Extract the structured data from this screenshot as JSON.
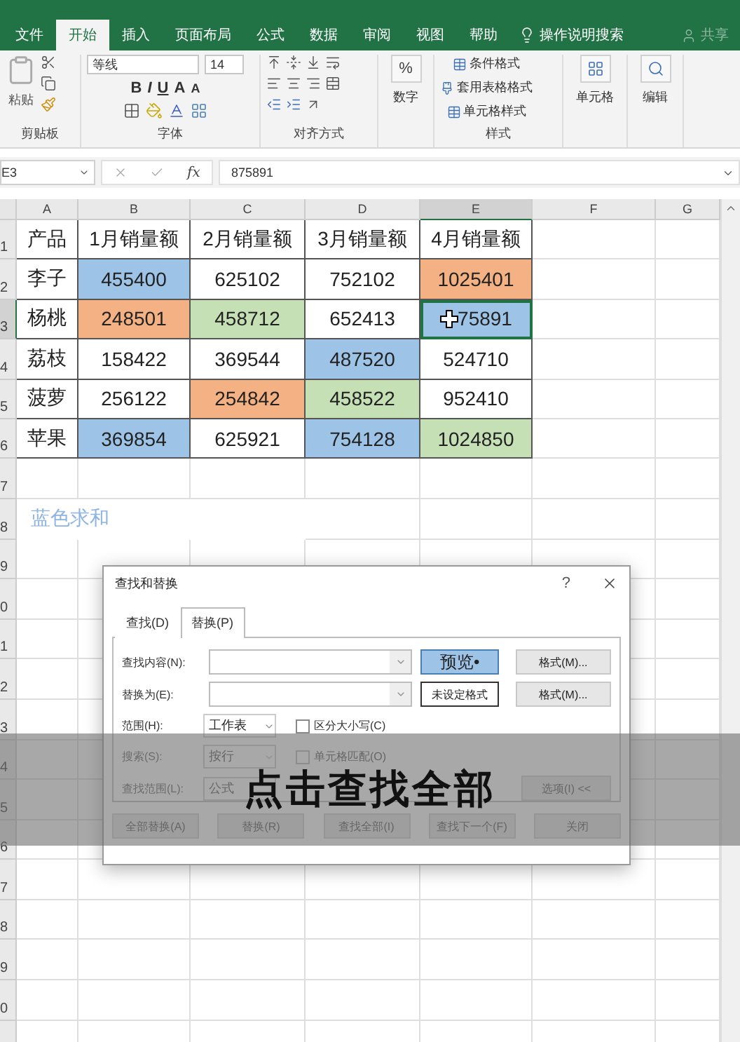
{
  "ribbon_tabs": [
    {
      "label": "文件",
      "selected": false
    },
    {
      "label": "开始",
      "selected": true
    },
    {
      "label": "插入",
      "selected": false
    },
    {
      "label": "页面布局",
      "selected": false
    },
    {
      "label": "公式",
      "selected": false
    },
    {
      "label": "数据",
      "selected": false
    },
    {
      "label": "审阅",
      "selected": false
    },
    {
      "label": "视图",
      "selected": false
    },
    {
      "label": "帮助",
      "selected": false
    }
  ],
  "tell_me": "操作说明搜索",
  "share": "共享",
  "ribbon": {
    "paste": "粘贴",
    "clipboard_label": "剪贴板",
    "font_name": "等线",
    "font_size": "14",
    "bold": "B",
    "italic": "I",
    "underline": "U",
    "grow": "A",
    "shrink": "A",
    "font_label": "字体",
    "align_label": "对齐方式",
    "percent": "%",
    "number": "数字",
    "styles": [
      "条件格式",
      "套用表格格式",
      "单元格样式"
    ],
    "styles_label": "样式",
    "cells": "单元格",
    "editing": "编辑"
  },
  "formula_bar": {
    "name_box": "E3",
    "fx": "fx",
    "formula": "875891"
  },
  "sheet": {
    "columns": [
      {
        "label": "A",
        "selected": false
      },
      {
        "label": "B",
        "selected": false
      },
      {
        "label": "C",
        "selected": false
      },
      {
        "label": "D",
        "selected": false
      },
      {
        "label": "E",
        "selected": true
      },
      {
        "label": "F",
        "selected": false
      },
      {
        "label": "G",
        "selected": false
      }
    ],
    "row_headers": [
      {
        "label": "1",
        "selected": false
      },
      {
        "label": "2",
        "selected": false
      },
      {
        "label": "3",
        "selected": true
      },
      {
        "label": "4",
        "selected": false
      },
      {
        "label": "5",
        "selected": false
      },
      {
        "label": "6",
        "selected": false
      },
      {
        "label": "7",
        "selected": false
      },
      {
        "label": "8",
        "selected": false
      },
      {
        "label": "9",
        "selected": false
      },
      {
        "label": "0",
        "selected": false
      },
      {
        "label": "1",
        "selected": false
      },
      {
        "label": "2",
        "selected": false
      },
      {
        "label": "3",
        "selected": false
      },
      {
        "label": "4",
        "selected": false
      },
      {
        "label": "5",
        "selected": false
      },
      {
        "label": "6",
        "selected": false
      },
      {
        "label": "7",
        "selected": false
      },
      {
        "label": "8",
        "selected": false
      },
      {
        "label": "9",
        "selected": false
      },
      {
        "label": "0",
        "selected": false
      }
    ],
    "rows": [
      {
        "cells": [
          {
            "text": "产品",
            "selected": false
          },
          {
            "text": "1月销量额",
            "selected": false
          },
          {
            "text": "2月销量额",
            "selected": false
          },
          {
            "text": "3月销量额",
            "selected": false
          },
          {
            "text": "4月销量额",
            "selected": false
          }
        ]
      },
      {
        "cells": [
          {
            "text": "李子",
            "selected": false
          },
          {
            "text": "455400",
            "selected": false,
            "color": "#9dc3e6"
          },
          {
            "text": "625102",
            "selected": false
          },
          {
            "text": "752102",
            "selected": false
          },
          {
            "text": "1025401",
            "selected": false,
            "color": "#f4b183"
          }
        ]
      },
      {
        "cells": [
          {
            "text": "杨桃",
            "selected": false
          },
          {
            "text": "248501",
            "selected": false,
            "color": "#f4b183"
          },
          {
            "text": "458712",
            "selected": false,
            "color": "#c5e0b4"
          },
          {
            "text": "652413",
            "selected": false
          },
          {
            "text": "75891",
            "selected": true,
            "color": "#9dc3e6"
          }
        ]
      },
      {
        "cells": [
          {
            "text": "荔枝",
            "selected": false
          },
          {
            "text": "158422",
            "selected": false
          },
          {
            "text": "369544",
            "selected": false
          },
          {
            "text": "487520",
            "selected": false,
            "color": "#9dc3e6"
          },
          {
            "text": "524710",
            "selected": false
          }
        ]
      },
      {
        "cells": [
          {
            "text": "菠萝",
            "selected": false
          },
          {
            "text": "256122",
            "selected": false
          },
          {
            "text": "254842",
            "selected": false,
            "color": "#f4b183"
          },
          {
            "text": "458522",
            "selected": false,
            "color": "#c5e0b4"
          },
          {
            "text": "952410",
            "selected": false
          }
        ]
      },
      {
        "cells": [
          {
            "text": "苹果",
            "selected": false
          },
          {
            "text": "369854",
            "selected": false,
            "color": "#9dc3e6"
          },
          {
            "text": "625921",
            "selected": false
          },
          {
            "text": "754128",
            "selected": false,
            "color": "#9dc3e6"
          },
          {
            "text": "1024850",
            "selected": false,
            "color": "#c5e0b4"
          }
        ]
      }
    ],
    "note": "蓝色求和"
  },
  "dialog": {
    "title": "查找和替换",
    "help": "?",
    "tabs": [
      {
        "label": "查找(D)",
        "selected": false
      },
      {
        "label": "替换(P)",
        "selected": true
      }
    ],
    "find_label": "查找内容(N):",
    "replace_label": "替换为(E):",
    "preview": "预览•",
    "no_format": "未设定格式",
    "format_buttons": [
      "格式(M)...",
      "格式(M)..."
    ],
    "within_label": "范围(H):",
    "within_value": "工作表",
    "match_case": {
      "label": "区分大小写(C)",
      "checked": false
    },
    "search_label": "搜索(S):",
    "search_value": "按行",
    "match_cell": {
      "label": "单元格匹配(O)",
      "checked": false
    },
    "look_in_label": "查找范围(L):",
    "look_in_value": "公式",
    "options": "选项(I) <<",
    "buttons": [
      "全部替换(A)",
      "替换(R)",
      "查找全部(I)",
      "查找下一个(F)",
      "关闭"
    ]
  },
  "caption": "点击查找全部"
}
